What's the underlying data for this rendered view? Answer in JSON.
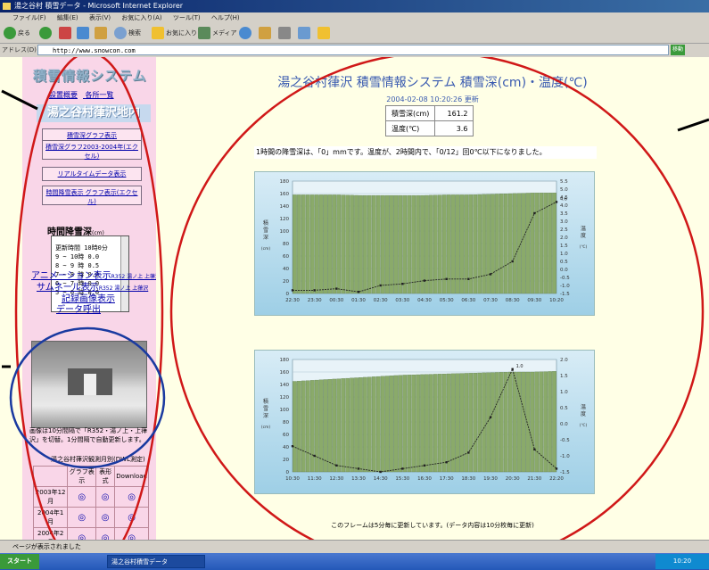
{
  "window": {
    "title": "湯之谷村 積雪データ - Microsoft Internet Explorer",
    "menu": [
      "ファイル(F)",
      "編集(E)",
      "表示(V)",
      "お気に入り(A)",
      "ツール(T)",
      "ヘルプ(H)"
    ],
    "toolbar": {
      "back": "戻る",
      "search": "検索",
      "favorites": "お気に入り",
      "media": "メディア"
    },
    "address_label": "アドレス(D)",
    "address": "http://www.snowcon.com",
    "go_label": "移動",
    "status": "ページが表示されました",
    "taskbar": {
      "start": "スタート",
      "task": "湯之谷村積雪データ",
      "tray": "10:20"
    }
  },
  "sidebar": {
    "title": "積雪情報システム",
    "links": [
      "設置概要",
      "各所一覧"
    ],
    "village": "湯之谷村葎沢地内",
    "buttons": [
      "積雪深グラフ表示",
      "積雪深グラフ2003-2004年(エクセル)",
      "リアルタイムデータ表示",
      "時間降雪表示 グラフ表示(エクセル)"
    ],
    "hourly_title": "時間降雪深",
    "hourly_unit": "(cm)",
    "hourly_list": [
      "更新時間 10時0分",
      "9 ~ 10時 0.0",
      "8 ~ 9 時 0.5",
      "7 ~ 8 時 0.0",
      "6 ~ 7 時 0.0",
      "5 ~ 6 時 0.0"
    ],
    "animation_link": "アニメーション表示",
    "animation_sub": "R352 湯ノ上 上葎沢",
    "thumbnail_link": "サムネール表示",
    "thumbnail_sub": "R352 湯ノ上 上葎沢",
    "record_link": "記録画像表示",
    "data_link": "データ呼出",
    "image_note": "画像は10分間隔で「R352・湯ノ上・上葎沢」を切替。1分間隔で自動更新します。",
    "table_caption": "湯之谷村葎沢観測月別(DWL測定)",
    "table_headers": [
      "",
      "グラフ表示",
      "表形式",
      "Download"
    ],
    "table_rows": [
      {
        "label": "2003年12月",
        "mark": "◎"
      },
      {
        "label": "2004年1月",
        "mark": "◎"
      },
      {
        "label": "2004年2月",
        "mark": "◎"
      }
    ]
  },
  "main": {
    "title": "湯之谷村葎沢 積雪情報システム 積雪深(cm)・温度(℃)",
    "updated": "2004-02-08 10:20:26 更新",
    "snow_label": "積雪深(cm)",
    "snow_value": "161.2",
    "temp_label": "温度(℃)",
    "temp_value": "3.6",
    "message": "1時間の降雪深は、「0」mmです。温度が、2時間内で、「0/12」回0℃以下になりました。",
    "footer": "このフレームは5分毎に更新しています。(データ内容は10分枚毎に更新)"
  },
  "chart_data": [
    {
      "type": "bar",
      "ylabel": "積雪深",
      "yunit": "(cm)",
      "y2label": "温度",
      "y2unit": "(℃)",
      "ylim": [
        0,
        180
      ],
      "y2lim": [
        -1.5,
        5.5
      ],
      "yticks": [
        "0",
        "20",
        "40",
        "60",
        "80",
        "100",
        "120",
        "140",
        "160",
        "180"
      ],
      "y2ticks": [
        "-1.5",
        "-1.0",
        "-0.5",
        "0.0",
        "0.5",
        "1.0",
        "1.5",
        "2.0",
        "2.5",
        "3.0",
        "3.5",
        "4.0",
        "4.5",
        "5.0",
        "5.5"
      ],
      "categories": [
        "22:30",
        "23:30",
        "00:30",
        "01:30",
        "02:30",
        "03:30",
        "04:30",
        "05:30",
        "06:30",
        "07:30",
        "08:30",
        "09:30",
        "10:20"
      ],
      "snow_depth": [
        158,
        158,
        158,
        157,
        157,
        157,
        157,
        158,
        158,
        159,
        160,
        161,
        161.2
      ],
      "temperature": [
        -1.3,
        -1.3,
        -1.2,
        -1.4,
        -1.0,
        -0.9,
        -0.7,
        -0.6,
        -0.6,
        -0.3,
        0.5,
        3.5,
        4.2
      ],
      "temp_annotation": "4.6"
    },
    {
      "type": "bar",
      "ylabel": "積雪深",
      "yunit": "(cm)",
      "y2label": "温度",
      "y2unit": "(℃)",
      "ylim": [
        0,
        180
      ],
      "y2lim": [
        -1.5,
        2.0
      ],
      "yticks": [
        "0",
        "20",
        "40",
        "60",
        "80",
        "100",
        "120",
        "140",
        "160",
        "180"
      ],
      "y2ticks": [
        "-1.5",
        "-1.0",
        "-0.5",
        "0.0",
        "0.5",
        "1.0",
        "1.5",
        "2.0"
      ],
      "categories": [
        "10:30",
        "11:30",
        "12:30",
        "13:30",
        "14:30",
        "15:30",
        "16:30",
        "17:30",
        "18:30",
        "19:30",
        "20:30",
        "21:30",
        "22:20"
      ],
      "snow_depth": [
        145,
        147,
        149,
        151,
        153,
        155,
        156,
        157,
        158,
        159,
        160,
        160,
        161
      ],
      "temperature": [
        -0.7,
        -1.0,
        -1.3,
        -1.4,
        -1.5,
        -1.4,
        -1.3,
        -1.2,
        -0.9,
        0.2,
        1.7,
        -0.8,
        -1.4
      ],
      "temp_annotation": "1.0"
    }
  ]
}
